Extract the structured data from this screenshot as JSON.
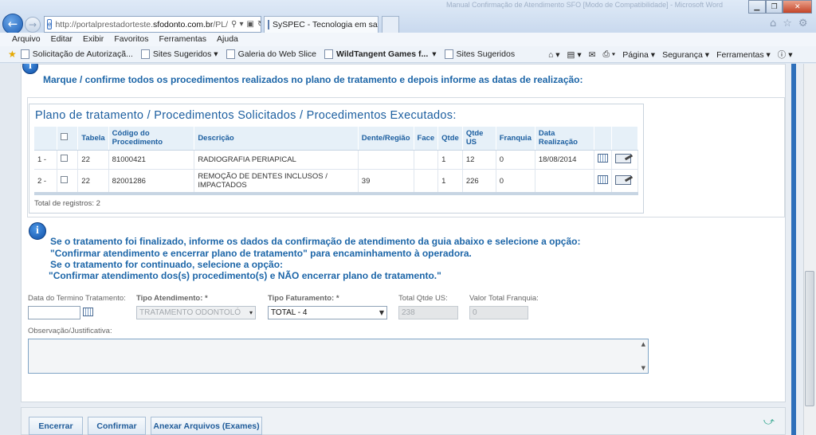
{
  "browser": {
    "window_title": "Manual Confirmação de Atendimento SFO [Modo de Compatibilidade] - Microsoft Word",
    "address_prefix": "http://portalprestadorteste.",
    "address_domain": "sfodonto.com.br",
    "address_suffix": "/PL/",
    "tab_title": "SySPEC - Tecnologia em sa...",
    "menu": [
      "Arquivo",
      "Editar",
      "Exibir",
      "Favoritos",
      "Ferramentas",
      "Ajuda"
    ],
    "favorites": [
      "Solicitação de Autorizaçã...",
      "Sites Sugeridos ▾",
      "Galeria do Web Slice",
      "WildTangent Games f...",
      "Sites Sugeridos"
    ],
    "commands": [
      "Página ▾",
      "Segurança ▾",
      "Ferramentas ▾"
    ]
  },
  "instruction_top": "Marque / confirme todos os procedimentos realizados no plano de tratamento e depois informe as datas de realização:",
  "table": {
    "title": "Plano de tratamento / Procedimentos Solicitados / Procedimentos Executados:",
    "headers": [
      "",
      "",
      "Tabela",
      "Código do Procedimento",
      "Descrição",
      "Dente/Região",
      "Face",
      "Qtde",
      "Qtde US",
      "Franquia",
      "Data Realização",
      "",
      ""
    ],
    "rows": [
      {
        "idx": "1 -",
        "tabela": "22",
        "codigo": "81000421",
        "descricao": "RADIOGRAFIA PERIAPICAL",
        "dente": "",
        "face": "",
        "qtde": "1",
        "qtde_us": "12",
        "franquia": "0",
        "data": "18/08/2014"
      },
      {
        "idx": "2 -",
        "tabela": "22",
        "codigo": "82001286",
        "descricao": "REMOÇÃO DE DENTES INCLUSOS / IMPACTADOS",
        "dente": "39",
        "face": "",
        "qtde": "1",
        "qtde_us": "226",
        "franquia": "0",
        "data": ""
      }
    ],
    "total_label": "Total de registros: 2"
  },
  "instructions": {
    "line1": "Se o tratamento foi finalizado, informe os dados da confirmação de atendimento da guia abaixo e selecione a opção:",
    "line2": "\"Confirmar atendimento e encerrar plano de tratamento\" para encaminhamento à operadora.",
    "line3": "Se o tratamento for continuado, selecione a opção:",
    "line4": "\"Confirmar atendimento dos(s) procedimento(s) e NÃO encerrar plano de tratamento.\""
  },
  "form": {
    "data_termino_label": "Data do Termino Tratamento:",
    "data_termino_value": "",
    "tipo_atendimento_label": "Tipo Atendimento: *",
    "tipo_atendimento_value": "TRATAMENTO ODONTOLÓ",
    "tipo_faturamento_label": "Tipo Faturamento: *",
    "tipo_faturamento_value": "TOTAL - 4",
    "total_qtde_label": "Total Qtde US:",
    "total_qtde_value": "238",
    "valor_franquia_label": "Valor Total Franquia:",
    "valor_franquia_value": "0",
    "observacao_label": "Observação/Justificativa:",
    "observacao_value": ""
  },
  "buttons": {
    "encerrar": "Encerrar",
    "confirmar": "Confirmar",
    "anexar": "Anexar Arquivos (Exames)"
  },
  "colors": {
    "accent": "#1d66a8",
    "header_bg": "#e6f0f8",
    "side_bar": "#2e6fba"
  }
}
